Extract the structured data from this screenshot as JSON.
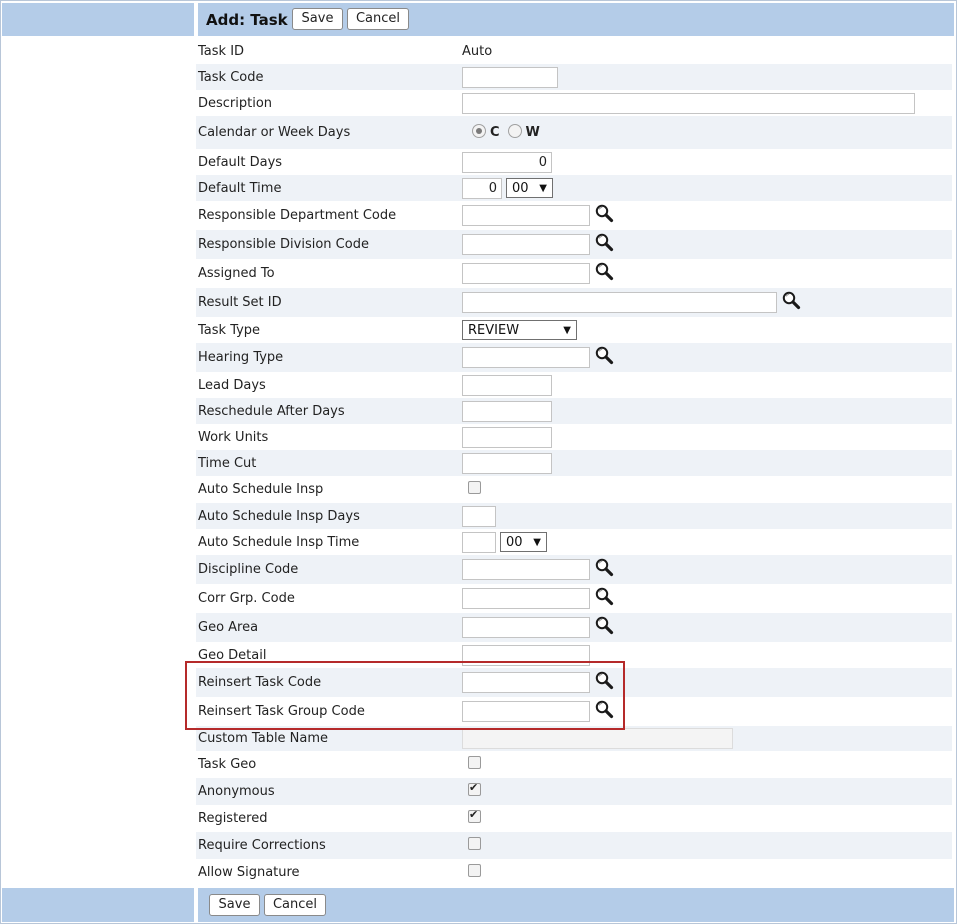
{
  "header": {
    "title": "Add: Task",
    "save_label": "Save",
    "cancel_label": "Cancel"
  },
  "footer": {
    "save_label": "Save",
    "cancel_label": "Cancel"
  },
  "fields": {
    "task_id": {
      "label": "Task ID",
      "value": "Auto"
    },
    "task_code": {
      "label": "Task Code",
      "value": ""
    },
    "description": {
      "label": "Description",
      "value": ""
    },
    "calendar_or_week_days": {
      "label": "Calendar or Week Days",
      "option_c": "C",
      "option_w": "W",
      "selected": "C"
    },
    "default_days": {
      "label": "Default Days",
      "value": "0"
    },
    "default_time": {
      "label": "Default Time",
      "hour": "0",
      "minute": "00"
    },
    "responsible_department_code": {
      "label": "Responsible Department Code",
      "value": ""
    },
    "responsible_division_code": {
      "label": "Responsible Division Code",
      "value": ""
    },
    "assigned_to": {
      "label": "Assigned To",
      "value": ""
    },
    "result_set_id": {
      "label": "Result Set ID",
      "value": ""
    },
    "task_type": {
      "label": "Task Type",
      "value": "REVIEW"
    },
    "hearing_type": {
      "label": "Hearing Type",
      "value": ""
    },
    "lead_days": {
      "label": "Lead Days",
      "value": ""
    },
    "reschedule_after_days": {
      "label": "Reschedule After Days",
      "value": ""
    },
    "work_units": {
      "label": "Work Units",
      "value": ""
    },
    "time_cut": {
      "label": "Time Cut",
      "value": ""
    },
    "auto_schedule_insp": {
      "label": "Auto Schedule Insp",
      "checked": false
    },
    "auto_schedule_insp_days": {
      "label": "Auto Schedule Insp Days",
      "value": ""
    },
    "auto_schedule_insp_time": {
      "label": "Auto Schedule Insp Time",
      "hour": "",
      "minute": "00"
    },
    "discipline_code": {
      "label": "Discipline Code",
      "value": ""
    },
    "corr_grp_code": {
      "label": "Corr Grp. Code",
      "value": ""
    },
    "geo_area": {
      "label": "Geo Area",
      "value": ""
    },
    "geo_detail": {
      "label": "Geo Detail",
      "value": ""
    },
    "reinsert_task_code": {
      "label": "Reinsert Task Code",
      "value": ""
    },
    "reinsert_task_group_code": {
      "label": "Reinsert Task Group Code",
      "value": ""
    },
    "custom_table_name": {
      "label": "Custom Table Name",
      "value": ""
    },
    "task_geo": {
      "label": "Task Geo",
      "checked": false
    },
    "anonymous": {
      "label": "Anonymous",
      "checked": true
    },
    "registered": {
      "label": "Registered",
      "checked": true
    },
    "require_corrections": {
      "label": "Require Corrections",
      "checked": false
    },
    "allow_signature": {
      "label": "Allow Signature",
      "checked": false
    }
  },
  "icons": {
    "lookup": "magnifier-icon",
    "checkmark": "check-icon"
  },
  "colors": {
    "header_bar": "#b4cce8",
    "alt_row": "#eef2f7",
    "highlight_border": "#b52a2a"
  }
}
